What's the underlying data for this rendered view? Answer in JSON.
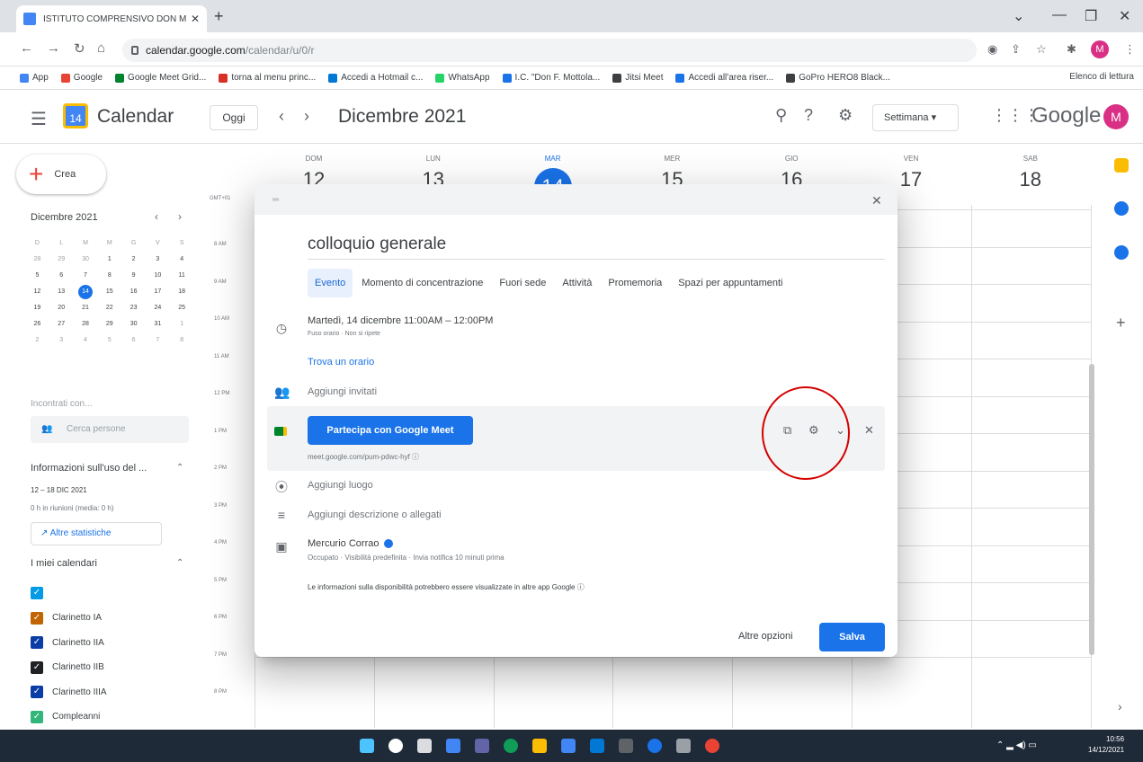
{
  "browser": {
    "tab_title": "ISTITUTO COMPRENSIVO DON M...",
    "tab_close": "✕",
    "new_tab": "+",
    "url_host": "calendar.google.com",
    "url_path": "/calendar/u/0/r",
    "profile_initial": "M",
    "bookmarks": [
      {
        "label": "App",
        "color": "#4285f4"
      },
      {
        "label": "Google",
        "color": "#ea4335"
      },
      {
        "label": "Google Meet Grid...",
        "color": "#00832d"
      },
      {
        "label": "torna al menu princ...",
        "color": "#d93025"
      },
      {
        "label": "Accedi a Hotmail c...",
        "color": "#0078d4"
      },
      {
        "label": "WhatsApp",
        "color": "#25d366"
      },
      {
        "label": "I.C. \"Don F. Mottola...",
        "color": "#1a73e8"
      },
      {
        "label": "Jitsi Meet",
        "color": "#3c4043"
      },
      {
        "label": "Accedi all'area riser...",
        "color": "#1a73e8"
      },
      {
        "label": "GoPro HERO8 Black...",
        "color": "#3c4043"
      }
    ],
    "reading_list": "Elenco di lettura"
  },
  "header": {
    "app_name": "Calendar",
    "logo_day": "14",
    "today_label": "Oggi",
    "month_label": "Dicembre 2021",
    "view_label": "Settimana",
    "google_word": "Google",
    "avatar_initial": "M"
  },
  "sidebar": {
    "create_label": "Crea",
    "mini_month": "Dicembre 2021",
    "weekday_initials": [
      "D",
      "L",
      "M",
      "M",
      "G",
      "V",
      "S"
    ],
    "mini_weeks": [
      [
        "28",
        "29",
        "30",
        "1",
        "2",
        "3",
        "4"
      ],
      [
        "5",
        "6",
        "7",
        "8",
        "9",
        "10",
        "11"
      ],
      [
        "12",
        "13",
        "14",
        "15",
        "16",
        "17",
        "18"
      ],
      [
        "19",
        "20",
        "21",
        "22",
        "23",
        "24",
        "25"
      ],
      [
        "26",
        "27",
        "28",
        "29",
        "30",
        "31",
        "1"
      ],
      [
        "2",
        "3",
        "4",
        "5",
        "6",
        "7",
        "8"
      ]
    ],
    "meet_with": "Incontrati con...",
    "search_people": "Cerca persone",
    "usage_title": "Informazioni sull'uso del ...",
    "usage_range": "12 – 18 DIC 2021",
    "usage_hours": "0 h in riunioni (media: 0 h)",
    "stats_button": "Altre statistiche",
    "my_calendars": "I miei calendari",
    "calendars": [
      {
        "name": "",
        "color": "#039be5"
      },
      {
        "name": "Clarinetto IA",
        "color": "#c26401"
      },
      {
        "name": "Clarinetto IIA",
        "color": "#0b3da6"
      },
      {
        "name": "Clarinetto IIB",
        "color": "#202124"
      },
      {
        "name": "Clarinetto IIIA",
        "color": "#0b3da6"
      },
      {
        "name": "Compleanni",
        "color": "#33b679"
      }
    ]
  },
  "week": {
    "gmt": "GMT+01",
    "days": [
      {
        "name": "DOM",
        "date": "12"
      },
      {
        "name": "LUN",
        "date": "13"
      },
      {
        "name": "MAR",
        "date": "14"
      },
      {
        "name": "MER",
        "date": "15"
      },
      {
        "name": "GIO",
        "date": "16"
      },
      {
        "name": "VEN",
        "date": "17"
      },
      {
        "name": "SAB",
        "date": "18"
      }
    ],
    "hours": [
      "8 AM",
      "9 AM",
      "10 AM",
      "11 AM",
      "12 PM",
      "1 PM",
      "2 PM",
      "3 PM",
      "4 PM",
      "5 PM",
      "6 PM",
      "7 PM",
      "8 PM"
    ]
  },
  "event": {
    "title": "colloquio generale",
    "tabs": [
      "Evento",
      "Momento di concentrazione",
      "Fuori sede",
      "Attività",
      "Promemoria",
      "Spazi per appuntamenti"
    ],
    "datetime": "Martedì, 14 dicembre   11:00AM  –  12:00PM",
    "datetime_sub": "Fuso orario · Non si ripete",
    "find_time": "Trova un orario",
    "add_guests": "Aggiungi invitati",
    "meet_button": "Partecipa con Google Meet",
    "meet_link": "meet.google.com/pum-pdwc-hyf",
    "add_location": "Aggiungi luogo",
    "add_description": "Aggiungi descrizione o allegati",
    "owner": "Mercurio Corrao",
    "owner_sub": "Occupato · Visibilità predefinita · Invia notifica 10 minuti prima",
    "availability_note": "Le informazioni sulla disponibilità potrebbero essere visualizzate in altre app Google",
    "more_options": "Altre opzioni",
    "save": "Salva"
  },
  "taskbar": {
    "time": "10:56",
    "date": "14/12/2021"
  }
}
